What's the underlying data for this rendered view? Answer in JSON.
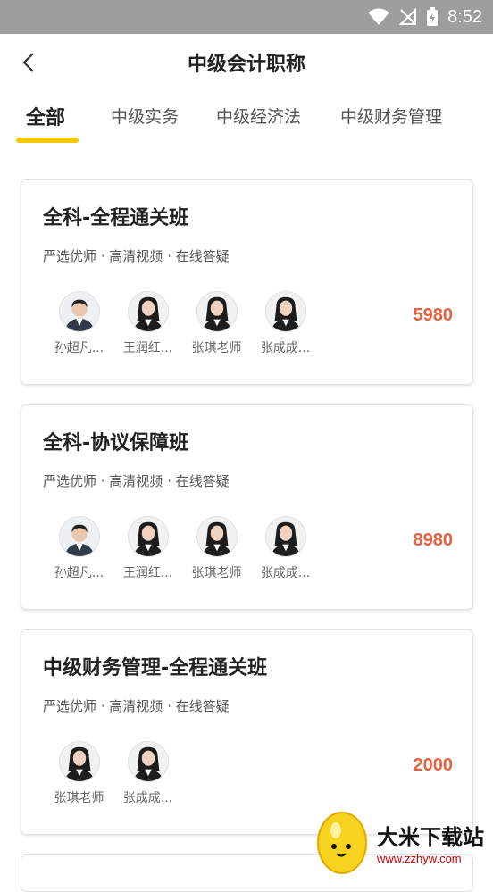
{
  "status_bar": {
    "time": "8:52"
  },
  "nav": {
    "title": "中级会计职称"
  },
  "tabs": [
    {
      "label": "全部",
      "active": true
    },
    {
      "label": "中级实务",
      "active": false
    },
    {
      "label": "中级经济法",
      "active": false
    },
    {
      "label": "中级财务管理",
      "active": false
    }
  ],
  "courses": [
    {
      "title": "全科-全程通关班",
      "subtitle": "严选优师 · 高清视频 · 在线答疑",
      "teachers": [
        {
          "name": "孙超凡...",
          "avatar": "male-teacher"
        },
        {
          "name": "王润红...",
          "avatar": "female-teacher"
        },
        {
          "name": "张琪老师",
          "avatar": "female-teacher"
        },
        {
          "name": "张成成...",
          "avatar": "female-teacher"
        }
      ],
      "price": "5980"
    },
    {
      "title": "全科-协议保障班",
      "subtitle": "严选优师 · 高清视频 · 在线答疑",
      "teachers": [
        {
          "name": "孙超凡...",
          "avatar": "male-teacher"
        },
        {
          "name": "王润红...",
          "avatar": "female-teacher"
        },
        {
          "name": "张琪老师",
          "avatar": "female-teacher"
        },
        {
          "name": "张成成...",
          "avatar": "female-teacher"
        }
      ],
      "price": "8980"
    },
    {
      "title": "中级财务管理-全程通关班",
      "subtitle": "严选优师 · 高清视频 · 在线答疑",
      "teachers": [
        {
          "name": "张琪老师",
          "avatar": "female-teacher"
        },
        {
          "name": "张成成...",
          "avatar": "female-teacher"
        }
      ],
      "price": "2000"
    }
  ],
  "watermark": {
    "text": "大米下载站",
    "url": "www.zzhyw.com"
  },
  "colors": {
    "accent": "#f6c800",
    "price": "#e8603c",
    "status_bar": "#9e9e9e"
  }
}
